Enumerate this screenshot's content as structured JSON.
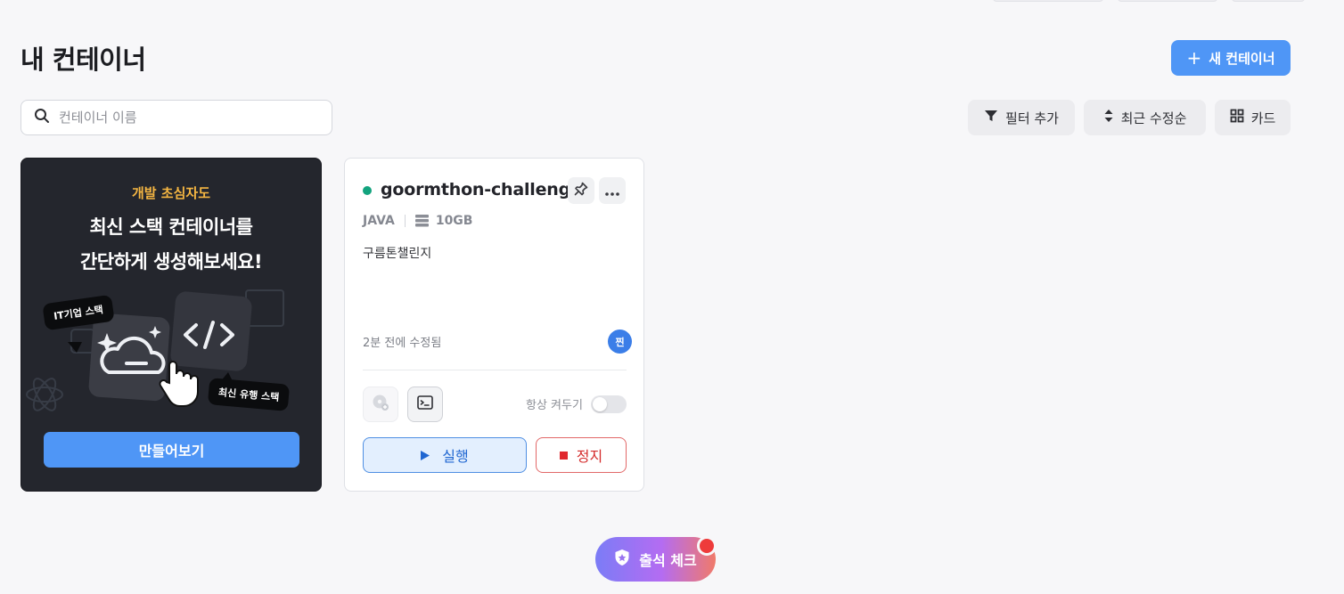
{
  "header": {
    "title": "내 컨테이너",
    "new_button_label": "새 컨테이너"
  },
  "search": {
    "placeholder": "컨테이너 이름",
    "value": ""
  },
  "toolbar": {
    "filter_label": "필터 추가",
    "sort_label": "최근 수정순",
    "view_label": "카드"
  },
  "promo": {
    "eyebrow": "개발 초심자도",
    "headline_line1": "최신 스택 컨테이너를",
    "headline_line2": "간단하게 생성해보세요!",
    "bubble_left": "IT기업 스택",
    "bubble_right": "최신 유행 스택",
    "button_label": "만들어보기"
  },
  "container_card": {
    "name": "goormthon-challenge",
    "status_color": "#13a37e",
    "stack": "JAVA",
    "storage": "10GB",
    "description": "구름톤챌린지",
    "modified": "2분 전에 수정됨",
    "owner_initial": "찐",
    "always_on_label": "항상 켜두기",
    "always_on": false,
    "run_label": "실행",
    "stop_label": "정지"
  },
  "attendance": {
    "label": "출석 체크"
  },
  "colors": {
    "accent": "#4f96f6",
    "promo_bg": "#24262d",
    "eyebrow": "#f5b642",
    "running": "#13a37e",
    "stop": "#e0282e"
  }
}
